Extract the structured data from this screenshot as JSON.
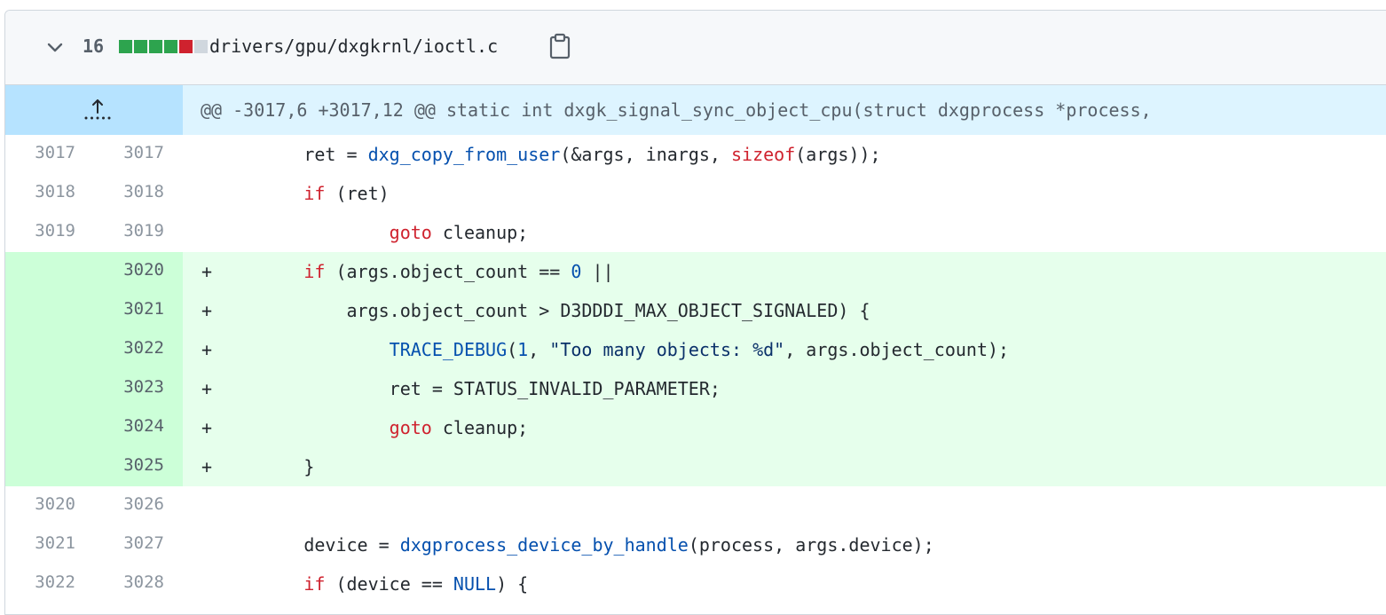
{
  "file": {
    "change_count": "16",
    "path": "drivers/gpu/dxgkrnl/ioctl.c",
    "diffstat": [
      "add",
      "add",
      "add",
      "add",
      "del",
      "neutral"
    ]
  },
  "hunk": {
    "header": "@@ -3017,6 +3017,12 @@ static int dxgk_signal_sync_object_cpu(struct dxgprocess *process,"
  },
  "colors": {
    "added_bg": "#e6ffec",
    "added_gutter_bg": "#ccffd8",
    "hunk_bg": "#ddf4ff",
    "keyword": "#cf222e",
    "function": "#0550ae"
  },
  "lines": [
    {
      "old": "3017",
      "new": "3017",
      "marker": "",
      "type": "context",
      "tokens": [
        {
          "t": "        ret = ",
          "c": "t"
        },
        {
          "t": "dxg_copy_from_user",
          "c": "fn"
        },
        {
          "t": "(&args, inargs, ",
          "c": "t"
        },
        {
          "t": "sizeof",
          "c": "kw"
        },
        {
          "t": "(args));",
          "c": "t"
        }
      ]
    },
    {
      "old": "3018",
      "new": "3018",
      "marker": "",
      "type": "context",
      "tokens": [
        {
          "t": "        ",
          "c": "t"
        },
        {
          "t": "if",
          "c": "kw"
        },
        {
          "t": " (ret)",
          "c": "t"
        }
      ]
    },
    {
      "old": "3019",
      "new": "3019",
      "marker": "",
      "type": "context",
      "tokens": [
        {
          "t": "                ",
          "c": "t"
        },
        {
          "t": "goto",
          "c": "kw"
        },
        {
          "t": " cleanup;",
          "c": "t"
        }
      ]
    },
    {
      "old": "",
      "new": "3020",
      "marker": "+",
      "type": "added",
      "tokens": [
        {
          "t": "        ",
          "c": "t"
        },
        {
          "t": "if",
          "c": "kw"
        },
        {
          "t": " (args.object_count == ",
          "c": "t"
        },
        {
          "t": "0",
          "c": "num"
        },
        {
          "t": " ||",
          "c": "t"
        }
      ]
    },
    {
      "old": "",
      "new": "3021",
      "marker": "+",
      "type": "added",
      "tokens": [
        {
          "t": "            args.object_count > D3DDDI_MAX_OBJECT_SIGNALED) {",
          "c": "t"
        }
      ]
    },
    {
      "old": "",
      "new": "3022",
      "marker": "+",
      "type": "added",
      "tokens": [
        {
          "t": "                ",
          "c": "t"
        },
        {
          "t": "TRACE_DEBUG",
          "c": "fn"
        },
        {
          "t": "(",
          "c": "t"
        },
        {
          "t": "1",
          "c": "num"
        },
        {
          "t": ", ",
          "c": "t"
        },
        {
          "t": "\"Too many objects: %d\"",
          "c": "str"
        },
        {
          "t": ", args.object_count);",
          "c": "t"
        }
      ]
    },
    {
      "old": "",
      "new": "3023",
      "marker": "+",
      "type": "added",
      "tokens": [
        {
          "t": "                ret = STATUS_INVALID_PARAMETER;",
          "c": "t"
        }
      ]
    },
    {
      "old": "",
      "new": "3024",
      "marker": "+",
      "type": "added",
      "tokens": [
        {
          "t": "                ",
          "c": "t"
        },
        {
          "t": "goto",
          "c": "kw"
        },
        {
          "t": " cleanup;",
          "c": "t"
        }
      ]
    },
    {
      "old": "",
      "new": "3025",
      "marker": "+",
      "type": "added",
      "tokens": [
        {
          "t": "        }",
          "c": "t"
        }
      ]
    },
    {
      "old": "3020",
      "new": "3026",
      "marker": "",
      "type": "context",
      "tokens": []
    },
    {
      "old": "3021",
      "new": "3027",
      "marker": "",
      "type": "context",
      "tokens": [
        {
          "t": "        device = ",
          "c": "t"
        },
        {
          "t": "dxgprocess_device_by_handle",
          "c": "fn"
        },
        {
          "t": "(process, args.device);",
          "c": "t"
        }
      ]
    },
    {
      "old": "3022",
      "new": "3028",
      "marker": "",
      "type": "context",
      "tokens": [
        {
          "t": "        ",
          "c": "t"
        },
        {
          "t": "if",
          "c": "kw"
        },
        {
          "t": " (device == ",
          "c": "t"
        },
        {
          "t": "NULL",
          "c": "fn"
        },
        {
          "t": ") {",
          "c": "t"
        }
      ]
    }
  ]
}
